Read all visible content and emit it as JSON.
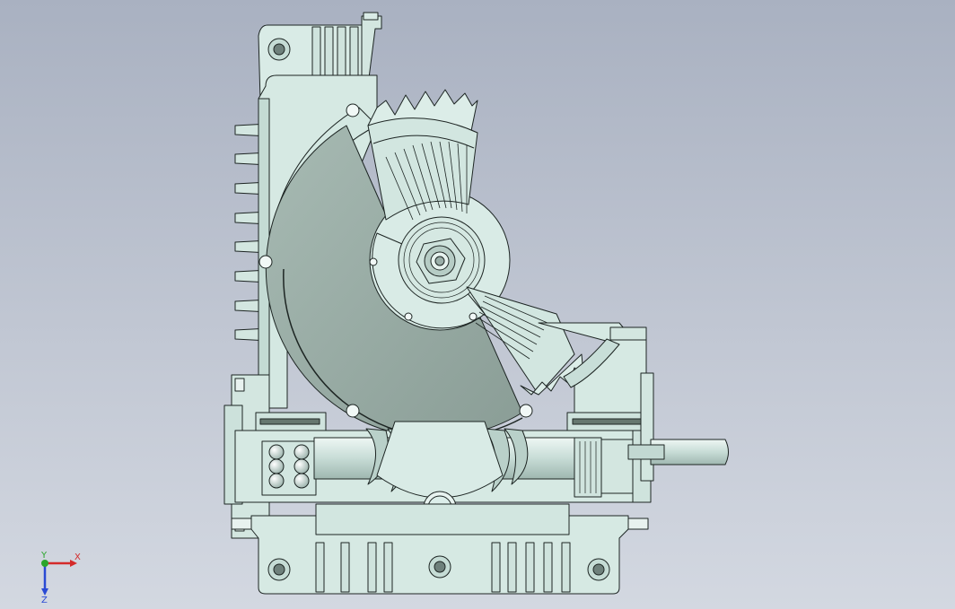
{
  "window": {
    "kind": "cad-viewport",
    "background_top": "#a9b1c1",
    "background_bottom": "#d3d8e1"
  },
  "model": {
    "view": "section-view",
    "colors": {
      "body": "#d9ebe6",
      "body_shade": "#bcd5cf",
      "edge": "#1d2523",
      "section_cut": "#9aaba5",
      "section_cut_dark": "#7f918b",
      "shaft": "#cfe2dc"
    }
  },
  "triad": {
    "axis_x": "X",
    "axis_y": "Y",
    "axis_z": "Z",
    "color_x": "#d42a2a",
    "color_y": "#2aa52a",
    "color_z": "#2a4ad4"
  }
}
